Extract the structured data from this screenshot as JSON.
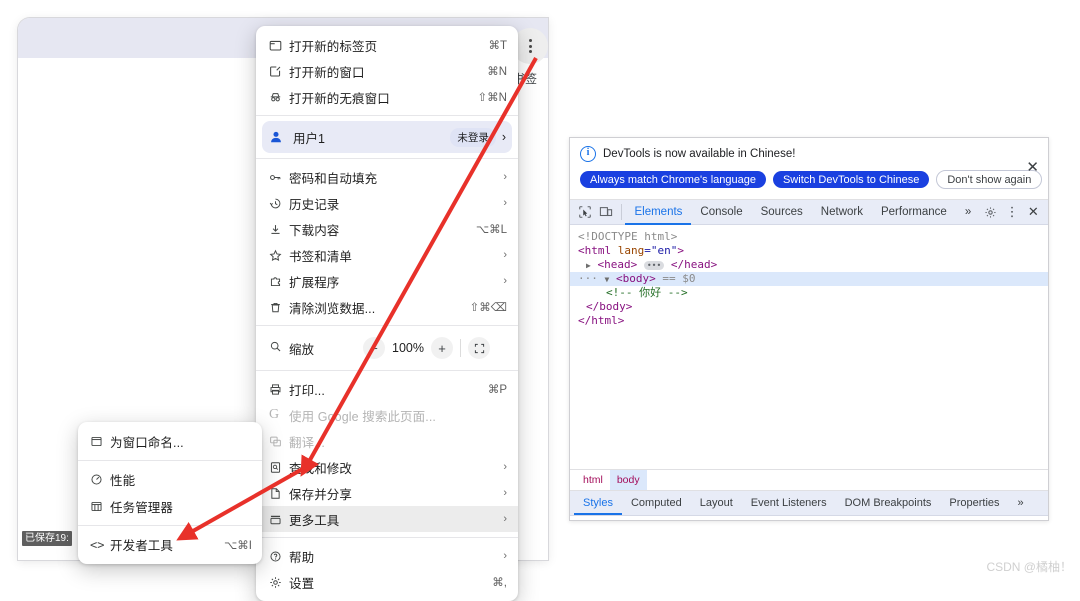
{
  "browser": {
    "bookmark_label": "书签",
    "saved_status": "已保存19:",
    "three_dot_name": "chrome-menu-button"
  },
  "chrome_menu": {
    "items": [
      {
        "icon": "new-tab-icon",
        "label": "打开新的标签页",
        "accel": "⌘T",
        "chevron": ""
      },
      {
        "icon": "new-window-icon",
        "label": "打开新的窗口",
        "accel": "⌘N",
        "chevron": ""
      },
      {
        "icon": "incognito-icon",
        "label": "打开新的无痕窗口",
        "accel": "⇧⌘N",
        "chevron": ""
      }
    ],
    "profile": {
      "icon": "person-icon",
      "label": "用户1",
      "badge": "未登录",
      "chevron": "›"
    },
    "group2": [
      {
        "icon": "key-icon",
        "label": "密码和自动填充",
        "accel": "",
        "chevron": "›"
      },
      {
        "icon": "history-icon",
        "label": "历史记录",
        "accel": "",
        "chevron": "›"
      },
      {
        "icon": "download-icon",
        "label": "下载内容",
        "accel": "⌥⌘L",
        "chevron": ""
      },
      {
        "icon": "star-icon",
        "label": "书签和清单",
        "accel": "",
        "chevron": "›"
      },
      {
        "icon": "extension-icon",
        "label": "扩展程序",
        "accel": "",
        "chevron": "›"
      },
      {
        "icon": "trash-icon",
        "label": "清除浏览数据...",
        "accel": "⇧⌘⌫",
        "chevron": ""
      }
    ],
    "zoom_row": {
      "icon": "zoom-icon",
      "label": "缩放",
      "minus": "−",
      "value": "100%",
      "plus": "+",
      "fullscreen_icon": "fullscreen-icon"
    },
    "group3": [
      {
        "icon": "print-icon",
        "label": "打印...",
        "accel": "⌘P",
        "chevron": "",
        "disabled": false
      },
      {
        "icon": "google-icon",
        "label": "使用 Google 搜索此页面...",
        "accel": "",
        "chevron": "",
        "disabled": true
      },
      {
        "icon": "translate-icon",
        "label": "翻译...",
        "accel": "",
        "chevron": "",
        "disabled": true
      },
      {
        "icon": "find-icon",
        "label": "查找和修改",
        "accel": "",
        "chevron": "›",
        "disabled": false
      },
      {
        "icon": "save-share-icon",
        "label": "保存并分享",
        "accel": "",
        "chevron": "›",
        "disabled": false
      },
      {
        "icon": "more-tools-icon",
        "label": "更多工具",
        "accel": "",
        "chevron": "›",
        "disabled": false,
        "highlighted": true
      }
    ],
    "group4": [
      {
        "icon": "help-icon",
        "label": "帮助",
        "accel": "",
        "chevron": "›"
      },
      {
        "icon": "settings-icon",
        "label": "设置",
        "accel": "⌘,",
        "chevron": ""
      }
    ]
  },
  "submenu": {
    "items": [
      {
        "icon": "window-name-icon",
        "label": "为窗口命名...",
        "accel": ""
      },
      {
        "icon": "performance-icon",
        "label": "性能",
        "accel": ""
      },
      {
        "icon": "task-manager-icon",
        "label": "任务管理器",
        "accel": ""
      },
      {
        "icon": "devtools-icon",
        "label": "开发者工具",
        "accel": "⌥⌘I"
      }
    ]
  },
  "devtools": {
    "notice": {
      "message": "DevTools is now available in Chinese!",
      "btn_always": "Always match Chrome's language",
      "btn_switch": "Switch DevTools to Chinese",
      "btn_dismiss": "Don't show again",
      "close_icon": "close-icon"
    },
    "tabs": [
      "Elements",
      "Console",
      "Sources",
      "Network",
      "Performance"
    ],
    "active_tab": "Elements",
    "overflow": "»",
    "toolbar_icons": [
      "inspect-icon",
      "device-toolbar-icon",
      "settings-gear-icon",
      "kebab-menu-icon",
      "close-icon"
    ],
    "dom": {
      "line1": "<!DOCTYPE html>",
      "line2_tag": "<html",
      "line2_attr": " lang",
      "line2_val": "=\"en\"",
      "line2_end": ">",
      "line3": "<head>",
      "line3_end": "</head>",
      "line4_tag": "<body>",
      "line4_marker": "== $0",
      "line5_comment": "<!-- 你好 -->",
      "line6": "</body>",
      "line7": "</html>"
    },
    "breadcrumbs": [
      "html",
      "body"
    ],
    "active_breadcrumb": "body",
    "side_tabs": [
      "Styles",
      "Computed",
      "Layout",
      "Event Listeners",
      "DOM Breakpoints",
      "Properties"
    ],
    "active_side_tab": "Styles",
    "side_overflow": "»"
  },
  "watermark": "CSDN @橘柚！",
  "colors": {
    "accent_blue": "#1a73e8",
    "pill_blue": "#1a40e0",
    "arrow_red": "#e8312a",
    "tabstrip": "#e6e7f2",
    "devtools_tabbar": "#e8ecf7"
  }
}
